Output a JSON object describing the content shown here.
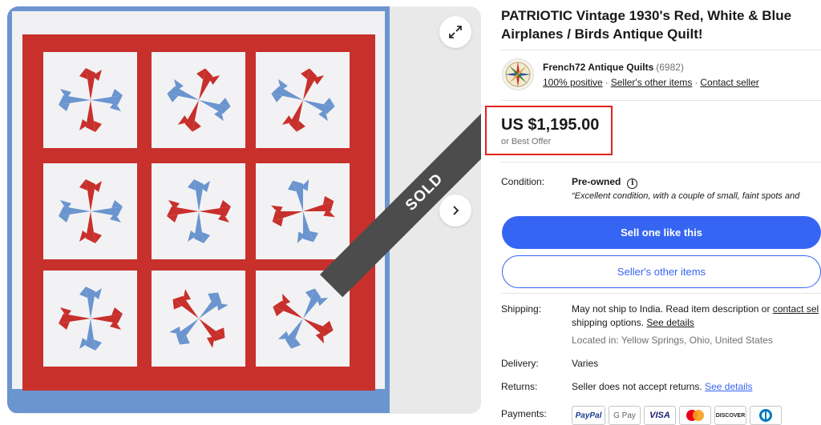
{
  "gallery": {
    "sold_label": "SOLD",
    "icons": {
      "expand": "expand-icon",
      "next": "chevron-right-icon"
    }
  },
  "listing": {
    "title": "PATRIOTIC Vintage 1930's Red, White & Blue Airplanes / Birds Antique Quilt!"
  },
  "seller": {
    "name": "French72 Antique Quilts",
    "feedback_count": "(6982)",
    "positive": "100% positive",
    "other_items": "Seller's other items",
    "contact": "Contact seller",
    "separator": "·"
  },
  "price": {
    "amount": "US $1,195.00",
    "best_offer": "or Best Offer",
    "highlight_color": "#e0211c"
  },
  "details": {
    "condition_label": "Condition:",
    "condition_value": "Pre-owned",
    "condition_quote": "“Excellent condition, with a couple of small, faint spots and",
    "shipping_label": "Shipping:",
    "shipping_text": "May not ship to India. Read item description or",
    "shipping_contact": "contact sel",
    "shipping_options": "shipping options.",
    "shipping_see_details": "See details",
    "located_in": "Located in: Yellow Springs, Ohio, United States",
    "delivery_label": "Delivery:",
    "delivery_value": "Varies",
    "returns_label": "Returns:",
    "returns_value": "Seller does not accept returns.",
    "returns_see_details": "See details",
    "payments_label": "Payments:"
  },
  "actions": {
    "primary": "Sell one like this",
    "secondary": "Seller's other items",
    "primary_color": "#3665f3"
  },
  "payments": [
    "PayPal",
    "G Pay",
    "VISA",
    "mastercard",
    "DISCOVER",
    "diners"
  ]
}
